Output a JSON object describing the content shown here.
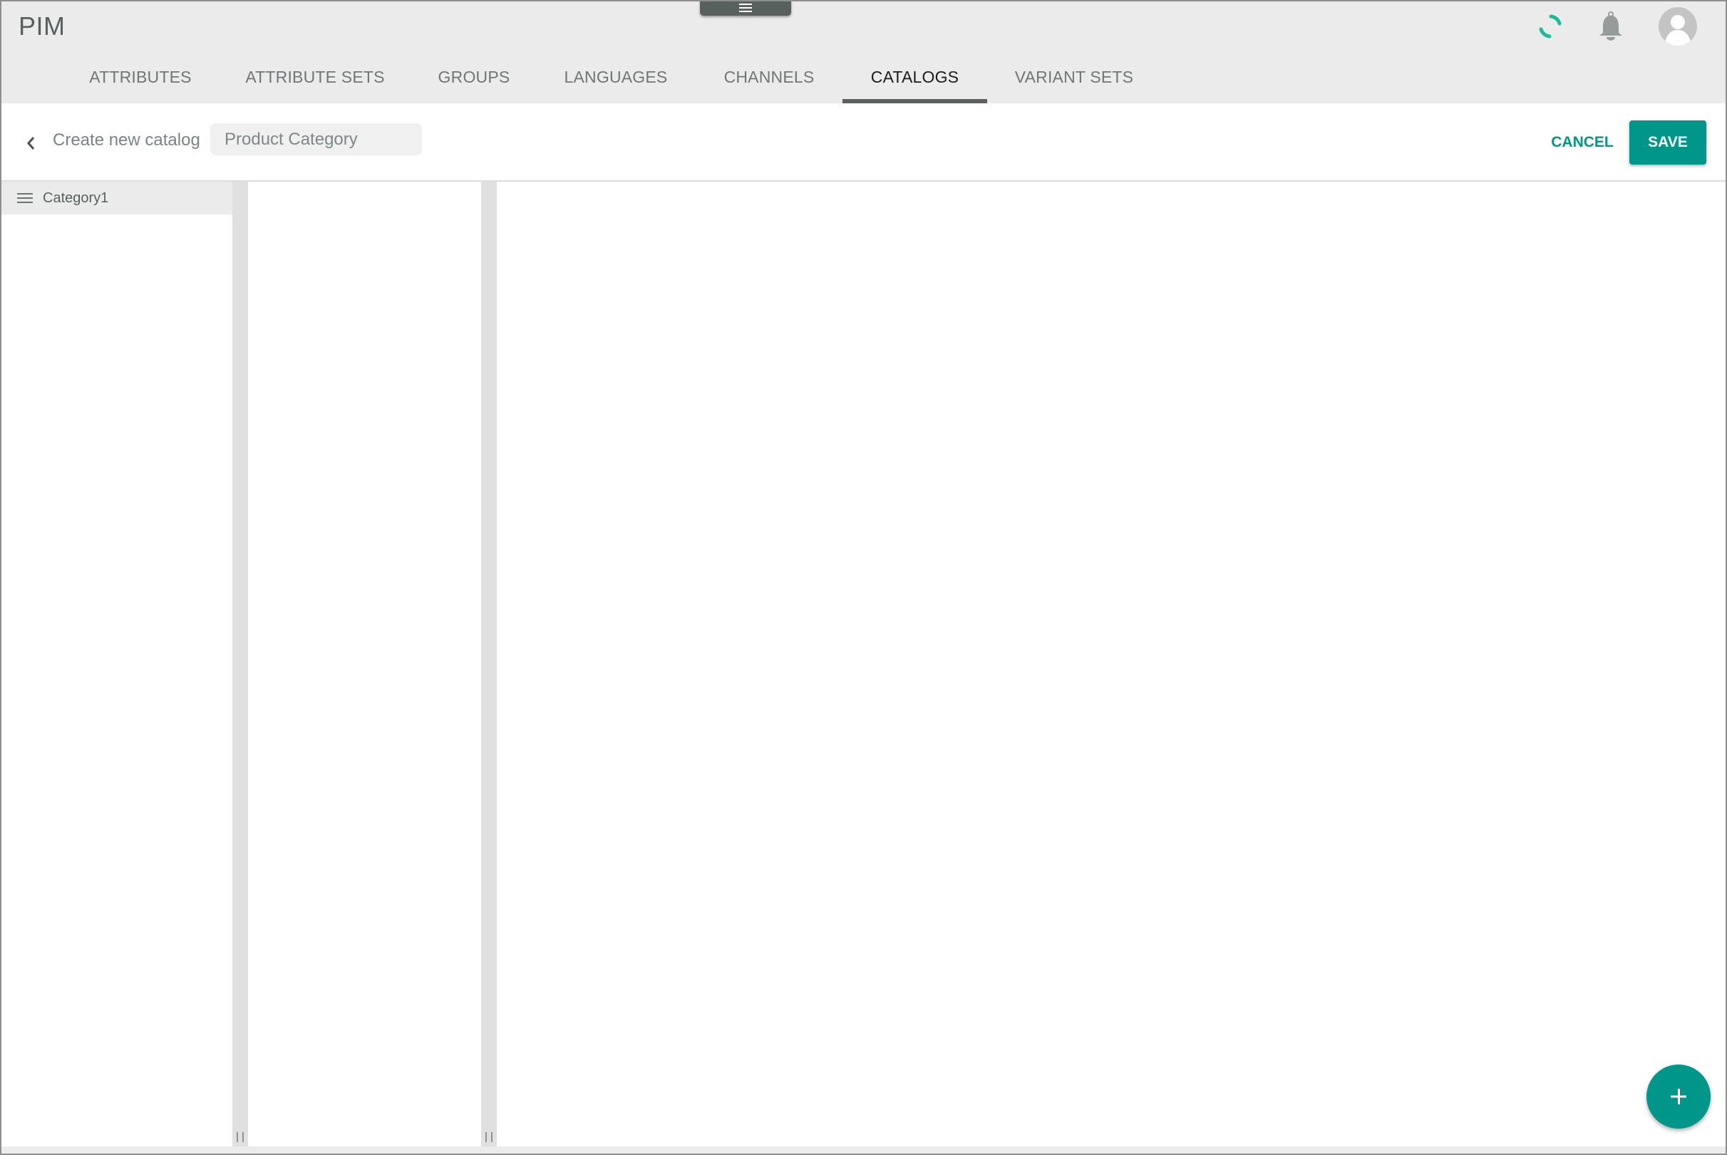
{
  "header": {
    "app_title": "PIM",
    "icons": {
      "menu_handle": "menu-icon",
      "loading": "loading-spinner-icon",
      "notifications": "bell-icon",
      "user": "user-avatar-icon"
    },
    "tabs": [
      {
        "label": "ATTRIBUTES",
        "active": false
      },
      {
        "label": "ATTRIBUTE SETS",
        "active": false
      },
      {
        "label": "GROUPS",
        "active": false
      },
      {
        "label": "LANGUAGES",
        "active": false
      },
      {
        "label": "CHANNELS",
        "active": false
      },
      {
        "label": "CATALOGS",
        "active": true
      },
      {
        "label": "VARIANT SETS",
        "active": false
      }
    ]
  },
  "toolbar": {
    "back_icon": "chevron-left-icon",
    "title": "Create new catalog",
    "name_input": {
      "value": "",
      "placeholder": "Product Category"
    },
    "cancel_label": "CANCEL",
    "save_label": "SAVE"
  },
  "tree": {
    "columns": [
      {
        "items": [
          {
            "label": "Category1",
            "icon": "drag-handle-icon",
            "selected": true
          }
        ]
      },
      {
        "items": []
      },
      {
        "items": []
      }
    ]
  },
  "fab": {
    "icon": "plus-icon",
    "label": "+"
  },
  "colors": {
    "accent": "#00968a",
    "header_bg": "#ebebeb",
    "tab_indicator": "#59615f",
    "spinner": "#1abc9c",
    "text_muted": "#7a8484"
  }
}
